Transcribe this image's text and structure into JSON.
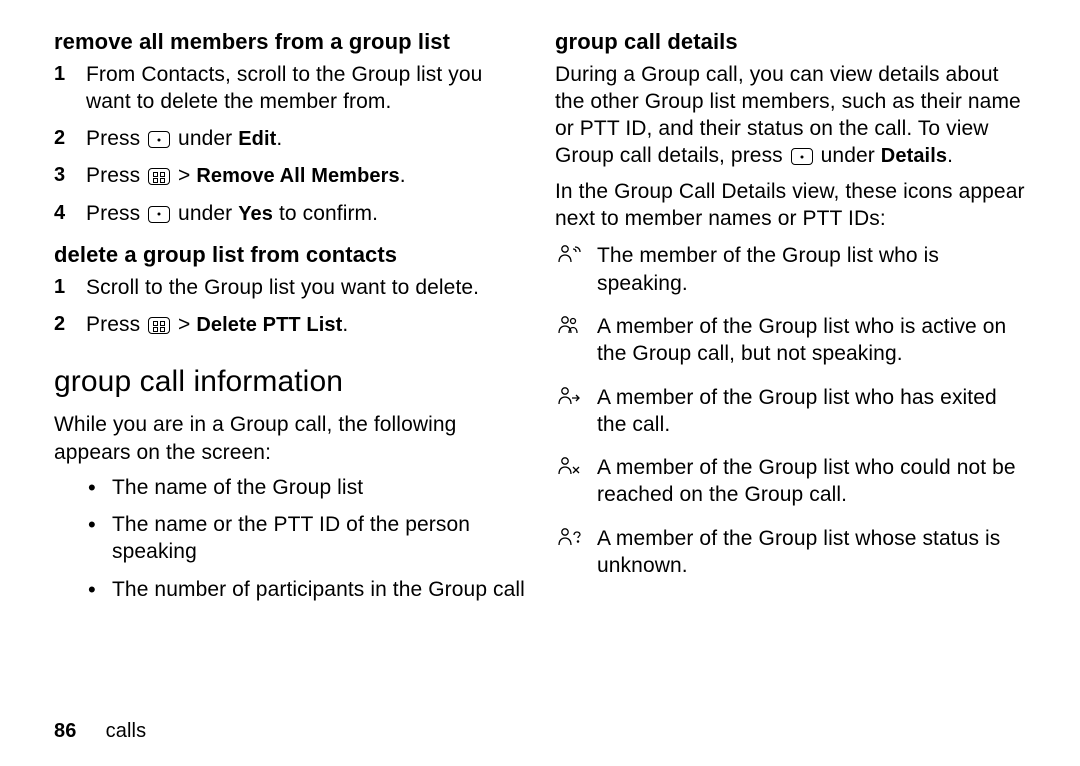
{
  "left": {
    "h_remove": "remove all members from a group list",
    "remove_steps": [
      "From Contacts, scroll to the Group list you want to delete the member from.",
      {
        "pre": "Press ",
        "icon": "dot",
        "mid": " under ",
        "bold": "Edit",
        "post": "."
      },
      {
        "pre": "Press ",
        "icon": "menu",
        "mid": " > ",
        "bold": "Remove All Members",
        "post": "."
      },
      {
        "pre": "Press ",
        "icon": "dot",
        "mid": " under ",
        "bold": "Yes",
        "post": " to confirm."
      }
    ],
    "h_delete": "delete a group list from contacts",
    "delete_steps": [
      "Scroll to the Group list you want to delete.",
      {
        "pre": "Press ",
        "icon": "menu",
        "mid": " > ",
        "bold": "Delete PTT List",
        "post": "."
      }
    ],
    "h_info": "group call information",
    "info_intro": "While you are in a Group call, the following appears on the screen:",
    "info_bullets": [
      "The name of the Group list",
      "The name or the PTT ID of the person speaking",
      "The number of participants in the Group call"
    ]
  },
  "right": {
    "h_details": "group call details",
    "details_p1_pre": "During a Group call, you can view details about the other Group list members, such as their name or PTT ID, and their status on the call. To view Group call details, press ",
    "details_p1_mid": " under ",
    "details_p1_bold": "Details",
    "details_p1_post": ".",
    "details_p2": "In the Group Call Details view, these icons appear next to member names or PTT IDs:",
    "icon_items": [
      {
        "icon": "speaking",
        "text": "The member of the Group list who is speaking."
      },
      {
        "icon": "active",
        "text": "A member of the Group list who is active on the Group call, but not speaking."
      },
      {
        "icon": "exited",
        "text": "A member of the Group list who has exited the call."
      },
      {
        "icon": "unreach",
        "text": "A member of the Group list who could not be reached on the Group call."
      },
      {
        "icon": "unknown",
        "text": "A member of the Group list whose status is unknown."
      }
    ]
  },
  "footer": {
    "page": "86",
    "section": "calls"
  }
}
